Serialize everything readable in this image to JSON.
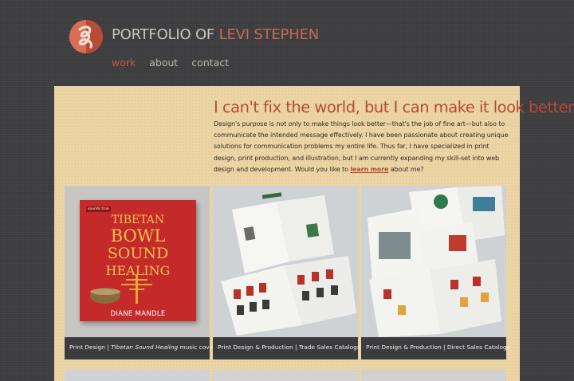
{
  "header": {
    "title_prefix": "PORTFOLIO OF ",
    "title_name": "LEVI STEPHEN"
  },
  "nav": {
    "items": [
      "work",
      "about",
      "contact"
    ],
    "active": "work"
  },
  "intro": {
    "headline": "I can't fix the world, but I can make it look better.",
    "body": "Design's purpose is not only to make things look better—that's the job of fine art—but also to communicate the intended message effectively. I have been passionate about creating unique solutions for communication problems my entire life. Thus far, I have specialized in print design, print production, and illustration, but I am currently expanding my skill-set into web design and development. Would you like to",
    "link_text": "learn more",
    "body_end": " about me?"
  },
  "cards": [
    {
      "caption_prefix": "Print Design | ",
      "caption_italic": "Tibetan Sound Healing",
      "caption_suffix": " music cover",
      "cover": {
        "publisher": "sounds true",
        "line1": "TIBETAN",
        "line2": "BOWL",
        "line3": "SOUND",
        "line4": "HEALING",
        "author": "DIANE MANDLE"
      }
    },
    {
      "caption_prefix": "Print Design & Production | Trade Sales Catalogs",
      "caption_italic": "",
      "caption_suffix": ""
    },
    {
      "caption_prefix": "Print Design & Production | Direct Sales Catalogs",
      "caption_italic": "",
      "caption_suffix": ""
    }
  ],
  "colors": {
    "background": "#3f3f41",
    "panel": "#ecd5a5",
    "accent": "#b64b34",
    "caption_bar": "#3c3c3e"
  }
}
